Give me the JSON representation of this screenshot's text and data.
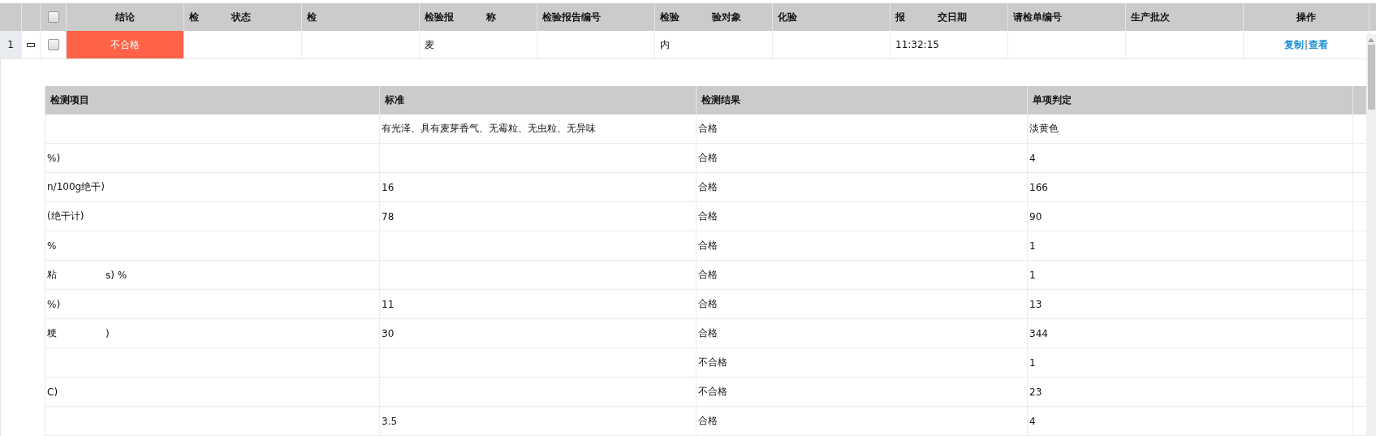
{
  "table": {
    "header_checkbox": {
      "checked": false
    },
    "conclusion_column": "结论",
    "columns": [
      {
        "parts": [
          "检",
          "状态"
        ]
      },
      "检",
      {
        "parts": [
          "检验报",
          "称"
        ]
      },
      "检验报告编号",
      {
        "parts": [
          "检验",
          "验对象"
        ]
      },
      "化验",
      {
        "parts": [
          "报",
          "交日期"
        ]
      },
      "请检单编号",
      "生产批次"
    ],
    "action_column": "操作",
    "rows": [
      {
        "index": "1",
        "expanded": true,
        "checked": false,
        "conclusion": {
          "text": "不合格",
          "kind": "fail"
        },
        "cells": [
          "",
          "",
          "麦",
          "",
          "内",
          "",
          "11:32:15",
          "",
          ""
        ],
        "actions": [
          "复制",
          "查看"
        ],
        "separator": "|"
      }
    ]
  },
  "detail": {
    "columns": [
      "检测项目",
      "标准",
      "检测结果",
      "单项判定"
    ],
    "rows": [
      {
        "item": "",
        "standard": "有光泽、具有麦芽香气、无霉粒、无虫粒、无异味",
        "result": "合格",
        "judgement": "淡黄色"
      },
      {
        "item": "%)",
        "standard": "",
        "result": "合格",
        "judgement": "4"
      },
      {
        "item": "n/100g绝干)",
        "standard": "16",
        "result": "合格",
        "judgement": "166"
      },
      {
        "item": "(绝干计)",
        "standard": "78",
        "result": "合格",
        "judgement": "90"
      },
      {
        "item": "%",
        "standard": "",
        "result": "合格",
        "judgement": "1"
      },
      {
        "item": {
          "parts": [
            "粘",
            "s) %"
          ]
        },
        "standard": "",
        "result": "合格",
        "judgement": "1"
      },
      {
        "item": "%)",
        "standard": "11",
        "result": "合格",
        "judgement": "13"
      },
      {
        "item": {
          "parts": [
            "粳",
            ")"
          ]
        },
        "standard": "30",
        "result": "合格",
        "judgement": "344"
      },
      {
        "item": "",
        "standard": "",
        "result": "不合格",
        "judgement": "1"
      },
      {
        "item": "C)",
        "standard": "",
        "result": "不合格",
        "judgement": "23"
      },
      {
        "item": "",
        "standard": "3.5",
        "result": "合格",
        "judgement": "4"
      }
    ]
  }
}
